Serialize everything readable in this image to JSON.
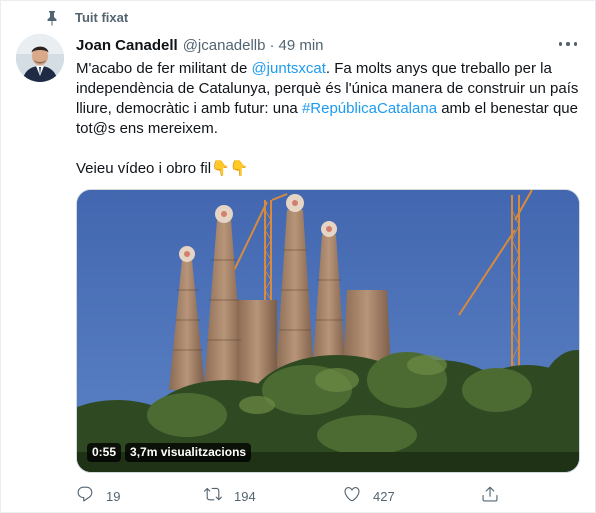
{
  "pinned": {
    "label": "Tuit fixat",
    "icon": "pin-icon"
  },
  "author": {
    "name": "Joan Canadell",
    "handle": "@jcanadellb",
    "separator": "·",
    "time": "49 min"
  },
  "tweet": {
    "line1_a": "M'acabo de fer militant de ",
    "mention": "@juntsxcat",
    "line1_b": ". Fa molts anys que treballo per la independència de Catalunya, perquè és l'única manera de construir un país lliure, democràtic i amb futur: una ",
    "hashtag": "#RepúblicaCatalana",
    "line1_c": " amb el benestar que tot@s ens mereixem.",
    "line2": "Veieu vídeo i obro fil",
    "emoji": "👇👇"
  },
  "video": {
    "duration": "0:55",
    "views": "3,7m visualitzacions"
  },
  "actions": {
    "reply": {
      "icon": "reply-icon",
      "count": "19"
    },
    "retweet": {
      "icon": "retweet-icon",
      "count": "194"
    },
    "like": {
      "icon": "heart-icon",
      "count": "427"
    },
    "share": {
      "icon": "share-icon"
    }
  },
  "colors": {
    "accent": "#1d9bf0",
    "muted": "#536471",
    "text": "#0f1419",
    "sky": "#4a6fb5"
  }
}
